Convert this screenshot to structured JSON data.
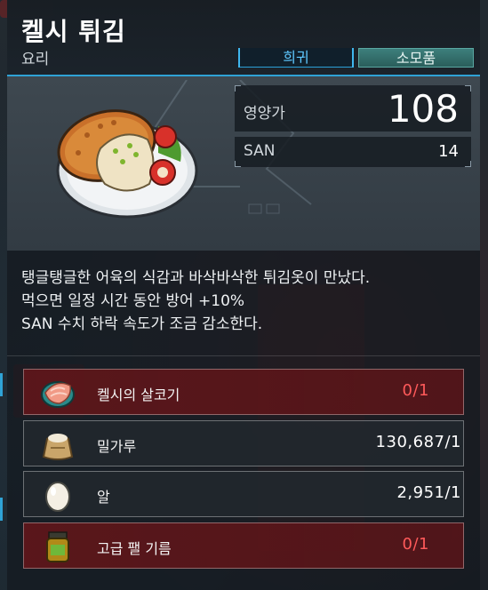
{
  "item": {
    "name": "켈시 튀김",
    "category": "요리",
    "rarity": "희귀",
    "type": "소모품"
  },
  "stats": {
    "nutrition_label": "영양가",
    "nutrition_value": "108",
    "san_label": "SAN",
    "san_value": "14"
  },
  "description": [
    "탱글탱글한 어육의 식감과 바삭바삭한 튀김옷이 만났다.",
    "먹으면 일정 시간 동안 방어 +10%",
    "SAN 수치 하락 속도가 조금 감소한다."
  ],
  "ingredients": [
    {
      "name": "켈시의 살코기",
      "count": "0/1",
      "sufficient": false,
      "icon": "fish-meat-icon"
    },
    {
      "name": "밀가루",
      "count": "130,687/1",
      "sufficient": true,
      "icon": "flour-sack-icon"
    },
    {
      "name": "알",
      "count": "2,951/1",
      "sufficient": true,
      "icon": "egg-icon"
    },
    {
      "name": "고급 팰 기름",
      "count": "0/1",
      "sufficient": false,
      "icon": "oil-jar-icon"
    }
  ],
  "colors": {
    "accent": "#2fa3d6",
    "rarity_text": "#5ec8ff",
    "lacking": "#ff5a5a",
    "category_tag": "#3d7f7c"
  }
}
